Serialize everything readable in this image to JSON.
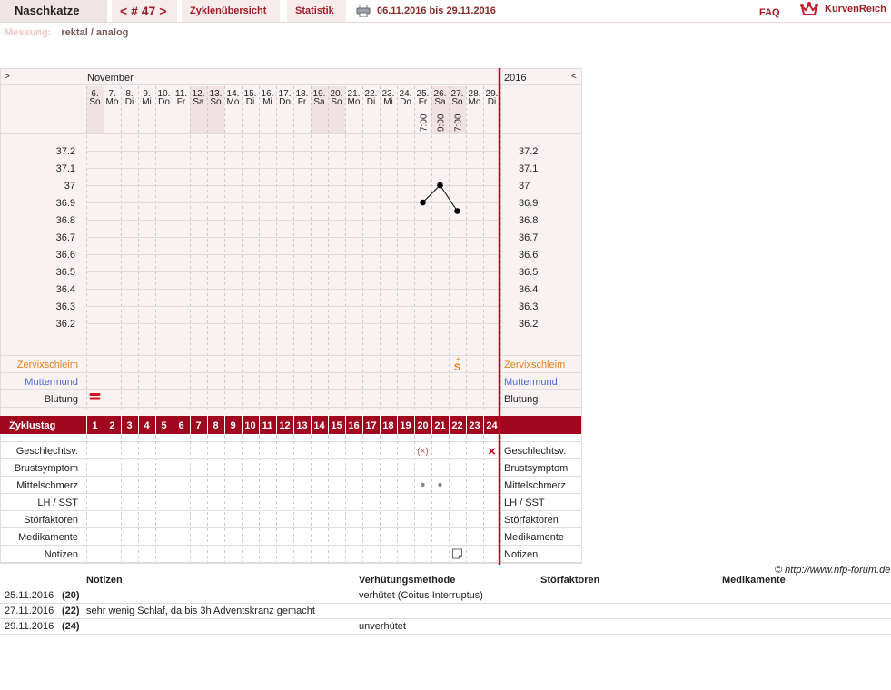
{
  "header": {
    "title": "Naschkatze",
    "cycle_nav": "< # 47 >",
    "tab_overview": "Zyklenübersicht",
    "tab_stats": "Statistik",
    "date_range": "06.11.2016 bis 29.11.2016",
    "faq": "FAQ",
    "brand": "KurvenReich"
  },
  "measurement": {
    "label": "Messung:",
    "value": "rektal / analog"
  },
  "chart": {
    "nav_left": ">",
    "nav_right": "<",
    "month": "November",
    "year": "2016",
    "days": [
      {
        "d": "6.",
        "w": "So",
        "we": true
      },
      {
        "d": "7.",
        "w": "Mo"
      },
      {
        "d": "8.",
        "w": "Di"
      },
      {
        "d": "9.",
        "w": "Mi"
      },
      {
        "d": "10.",
        "w": "Do"
      },
      {
        "d": "11.",
        "w": "Fr"
      },
      {
        "d": "12.",
        "w": "Sa",
        "we": true
      },
      {
        "d": "13.",
        "w": "So",
        "we": true
      },
      {
        "d": "14.",
        "w": "Mo"
      },
      {
        "d": "15.",
        "w": "Di"
      },
      {
        "d": "16.",
        "w": "Mi"
      },
      {
        "d": "17.",
        "w": "Do"
      },
      {
        "d": "18.",
        "w": "Fr"
      },
      {
        "d": "19.",
        "w": "Sa",
        "we": true
      },
      {
        "d": "20.",
        "w": "So",
        "we": true
      },
      {
        "d": "21.",
        "w": "Mo"
      },
      {
        "d": "22.",
        "w": "Di"
      },
      {
        "d": "23.",
        "w": "Mi"
      },
      {
        "d": "24.",
        "w": "Do"
      },
      {
        "d": "25.",
        "w": "Fr"
      },
      {
        "d": "26.",
        "w": "Sa",
        "we": true
      },
      {
        "d": "27.",
        "w": "So",
        "we": true
      },
      {
        "d": "28.",
        "w": "Mo"
      },
      {
        "d": "29.",
        "w": "Di"
      }
    ],
    "times": [
      {
        "cycle_day": 20,
        "time": "7:00"
      },
      {
        "cycle_day": 21,
        "time": "9:00"
      },
      {
        "cycle_day": 22,
        "time": "7:00"
      }
    ],
    "temp_ticks": [
      "37.2",
      "37.1",
      "37",
      "36.9",
      "36.8",
      "36.7",
      "36.6",
      "36.5",
      "36.4",
      "36.3",
      "36.2"
    ],
    "temp_min": 36.1,
    "temp_max": 37.3,
    "labels": {
      "cervical_mucus": "Zervixschleim",
      "cervix": "Muttermund",
      "bleeding": "Blutung",
      "cycle_day": "Zyklustag",
      "intercourse": "Geschlechtsv.",
      "breast": "Brustsymptom",
      "midpain": "Mittelschmerz",
      "lh": "LH / SST",
      "disturbance": "Störfaktoren",
      "medication": "Medikamente",
      "notes": "Notizen"
    },
    "mucus_marks": [
      {
        "cycle_day": 22,
        "symbol": "S+"
      }
    ],
    "bleeding_marks": [
      {
        "cycle_day": 1,
        "level": "normal"
      }
    ],
    "intercourse_marks": [
      {
        "cycle_day": 20,
        "symbol": "(×)"
      },
      {
        "cycle_day": 24,
        "symbol": "×"
      }
    ],
    "midpain_marks": [
      {
        "cycle_day": 20
      },
      {
        "cycle_day": 21
      }
    ],
    "note_marks": [
      {
        "cycle_day": 22
      }
    ],
    "colors": {
      "accent": "#a0071e",
      "mucus": "#e8821c",
      "cervix": "#4a67d0",
      "bg": "#f9f2f2",
      "weekend": "#f1e3e3"
    }
  },
  "chart_data": {
    "type": "line",
    "xlabel": "Zyklustag",
    "ylabel": "",
    "ylim": [
      36.1,
      37.3
    ],
    "x": [
      20,
      21,
      22
    ],
    "series": [
      {
        "values": [
          36.9,
          37.0,
          36.85
        ]
      }
    ]
  },
  "copyright": "© http://www.nfp-forum.de",
  "notes_table": {
    "headers": [
      "Notizen",
      "Verhütungsmethode",
      "Störfaktoren",
      "Medikamente"
    ],
    "rows": [
      {
        "date": "25.11.2016",
        "day": "(20)",
        "note": "",
        "method": "verhütet (Coitus Interruptus)"
      },
      {
        "date": "27.11.2016",
        "day": "(22)",
        "note": "sehr wenig Schlaf, da bis 3h Adventskranz gemacht",
        "method": ""
      },
      {
        "date": "29.11.2016",
        "day": "(24)",
        "note": "",
        "method": "unverhütet"
      }
    ]
  }
}
